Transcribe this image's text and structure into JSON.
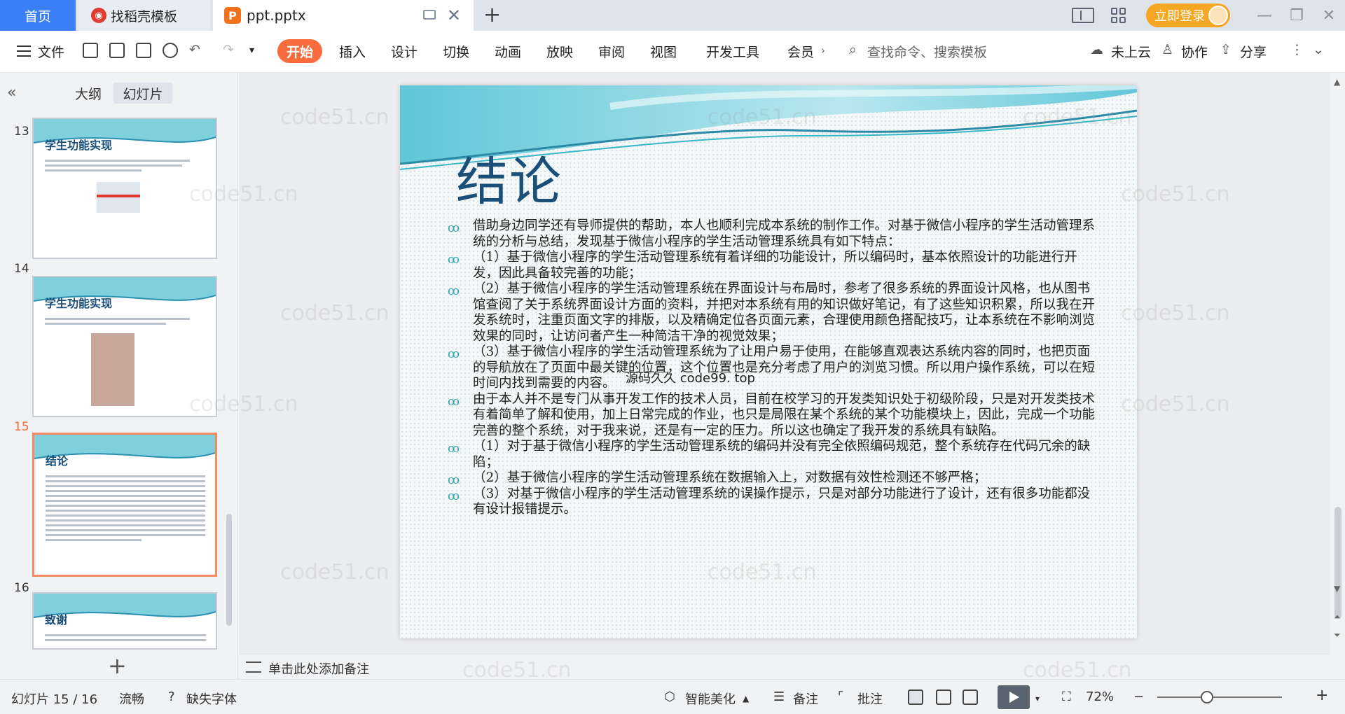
{
  "titlebar": {
    "home_tab": "首页",
    "template_tab": "找稻壳模板",
    "doc_tab": "ppt.pptx",
    "login": "立即登录"
  },
  "ribbon": {
    "file": "文件",
    "tabs": [
      "开始",
      "插入",
      "设计",
      "切换",
      "动画",
      "放映",
      "审阅",
      "视图",
      "开发工具",
      "会员"
    ],
    "search_placeholder": "查找命令、搜索模板",
    "cloud": "未上云",
    "collab": "协作",
    "share": "分享"
  },
  "leftpanel": {
    "tab_outline": "大纲",
    "tab_slides": "幻灯片",
    "thumbnails": [
      {
        "num": "13",
        "title": "学生功能实现"
      },
      {
        "num": "14",
        "title": "学生功能实现"
      },
      {
        "num": "15",
        "title": "结论"
      },
      {
        "num": "16",
        "title": "致谢"
      }
    ]
  },
  "slide": {
    "title": "结论",
    "bullets": [
      "借助身边同学还有导师提供的帮助，本人也顺利完成本系统的制作工作。对基于微信小程序的学生活动管理系统的分析与总结，发现基于微信小程序的学生活动管理系统具有如下特点：",
      "（1）基于微信小程序的学生活动管理系统有着详细的功能设计，所以编码时，基本依照设计的功能进行开发，因此具备较完善的功能；",
      "（2）基于微信小程序的学生活动管理系统在界面设计与布局时，参考了很多系统的界面设计风格，也从图书馆查阅了关于系统界面设计方面的资料，并把对本系统有用的知识做好笔记，有了这些知识积累，所以我在开发系统时，注重页面文字的排版，以及精确定位各页面元素，合理使用颜色搭配技巧，让本系统在不影响浏览效果的同时，让访问者产生一种简洁干净的视觉效果；",
      "（3）基于微信小程序的学生活动管理系统为了让用户易于使用，在能够直观表达系统内容的同时，也把页面的导航放在了页面中最关键的位置，这个位置也是充分考虑了用户的浏览习惯。所以用户操作系统，可以在短时间内找到需要的内容。",
      "由于本人并不是专门从事开发工作的技术人员，目前在校学习的开发类知识处于初级阶段，只是对开发类技术有着简单了解和使用，加上日常完成的作业，也只是局限在某个系统的某个功能模块上，因此，完成一个功能完善的整个系统，对于我来说，还是有一定的压力。所以这也确定了我开发的系统具有缺陷。",
      "（1）对于基于微信小程序的学生活动管理系统的编码并没有完全依照编码规范，整个系统存在代码冗余的缺陷；",
      "（2）基于微信小程序的学生活动管理系统在数据输入上，对数据有效性检测还不够严格；",
      "（3）对基于微信小程序的学生活动管理系统的误操作提示，只是对部分功能进行了设计，还有很多功能都没有设计报错提示。"
    ],
    "overlay": "源码久久 code99. top"
  },
  "notes": {
    "placeholder": "单击此处添加备注"
  },
  "statusbar": {
    "slide_info": "幻灯片 15 / 16",
    "theme": "流畅",
    "missing_font": "缺失字体",
    "beautify": "智能美化",
    "notes": "备注",
    "comment": "批注",
    "zoom": "72%"
  },
  "watermark": "code51.cn",
  "colors": {
    "accent": "#f76b3c",
    "home_tab": "#3b7ef5",
    "title": "#1a4f7a",
    "bullet": "#2aa6b8"
  }
}
